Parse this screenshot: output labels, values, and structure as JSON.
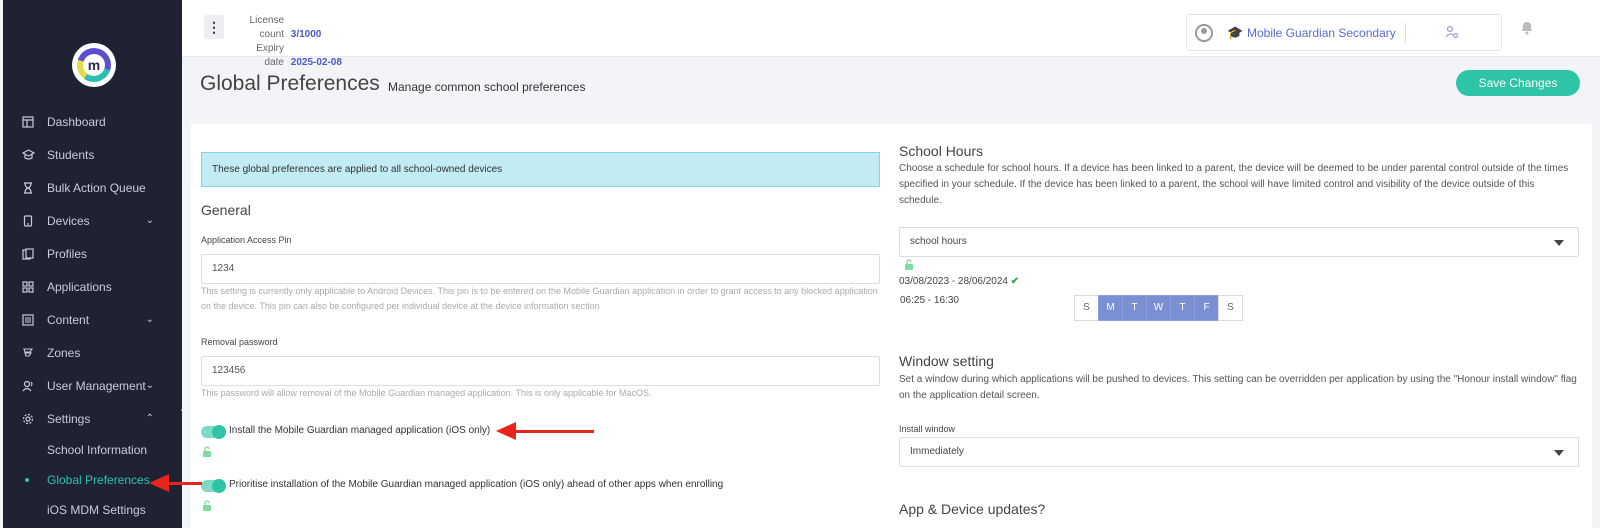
{
  "sidebar": {
    "logo_letter": "m",
    "items": [
      {
        "label": "Dashboard",
        "icon": "dashboard-icon"
      },
      {
        "label": "Students",
        "icon": "students-icon"
      },
      {
        "label": "Bulk Action Queue",
        "icon": "hourglass-icon"
      },
      {
        "label": "Devices",
        "icon": "device-icon",
        "expandable": true
      },
      {
        "label": "Profiles",
        "icon": "profiles-icon"
      },
      {
        "label": "Applications",
        "icon": "applications-icon"
      },
      {
        "label": "Content",
        "icon": "content-icon",
        "expandable": true
      },
      {
        "label": "Zones",
        "icon": "zones-icon"
      },
      {
        "label": "User Management",
        "icon": "users-icon",
        "expandable": true
      },
      {
        "label": "Settings",
        "icon": "gear-icon",
        "expanded": true
      }
    ],
    "settings_sub": [
      {
        "label": "School Information"
      },
      {
        "label": "Global Preferences",
        "active": true
      },
      {
        "label": "iOS MDM Settings"
      }
    ]
  },
  "topbar": {
    "license_label": "License count",
    "license_value": "3/1000",
    "expiry_label": "Expiry date",
    "expiry_value": "2025-02-08",
    "school_name": "Mobile Guardian Secondary"
  },
  "header": {
    "title": "Global Preferences",
    "subtitle": "Manage common school preferences",
    "save_label": "Save Changes"
  },
  "left": {
    "banner": "These global preferences are applied to all school-owned devices",
    "general_title": "General",
    "pin_label": "Application Access Pin",
    "pin_value": "1234",
    "pin_help": "This setting is currently only applicable to Android Devices. This pin is to be entered on the Mobile Guardian application in order to grant access to any blocked application on the device. This pin can also be configured per individual device at the device information section",
    "removal_label": "Removal password",
    "removal_value": "123456",
    "removal_help": "This password will allow removal of the Mobile Guardian managed application. This is only applicable for MacOS.",
    "toggle1_label": "Install the Mobile Guardian managed application (iOS only)",
    "toggle1_on": true,
    "toggle2_label": "Prioritise installation of the Mobile Guardian managed application (iOS only) ahead of other apps when enrolling",
    "toggle2_on": true
  },
  "right": {
    "school_hours_title": "School Hours",
    "school_hours_text": "Choose a schedule for school hours. If a device has been linked to a parent, the device will be deemed to be under parental control outside of the times specified in your schedule. If the device has been linked to a parent, the school will have limited control and visibility of the device outside of this schedule.",
    "schedule_select": "school hours",
    "date_range": "03/08/2023 - 28/06/2024",
    "time_range": "06:25 - 16:30",
    "days": [
      {
        "label": "S",
        "on": false
      },
      {
        "label": "M",
        "on": true
      },
      {
        "label": "T",
        "on": true
      },
      {
        "label": "W",
        "on": true
      },
      {
        "label": "T",
        "on": true
      },
      {
        "label": "F",
        "on": true
      },
      {
        "label": "S",
        "on": false
      }
    ],
    "window_title": "Window setting",
    "window_text": "Set a window during which applications will be pushed to devices. This setting can be overridden per application by using the \"Honour install window\" flag on the application detail screen.",
    "install_label": "Install window",
    "install_value": "Immediately",
    "updates_title": "App & Device updates?"
  },
  "colors": {
    "sidebar_bg": "#1e2233",
    "accent": "#2ec4a6",
    "link": "#4e59c9",
    "banner_bg": "#c2ecf3",
    "day_on": "#7b8fd4",
    "annotation": "#e8241c"
  }
}
